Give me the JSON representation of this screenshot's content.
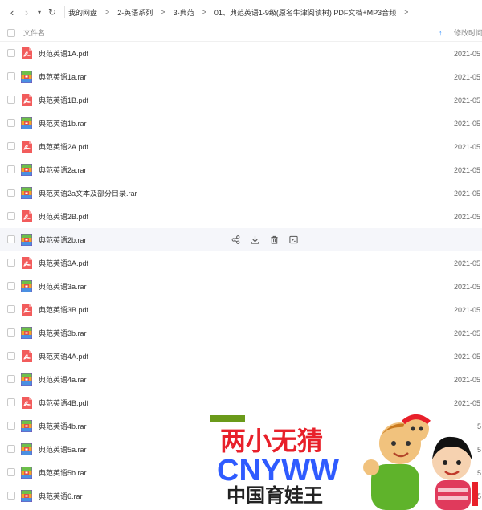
{
  "breadcrumb": [
    "我的网盘",
    "2-英语系列",
    "3-典范",
    "01、典范英语1-9级(原名牛津阅读树) PDF文档+MP3音频"
  ],
  "header": {
    "name": "文件名",
    "modified": "修改时间"
  },
  "files": [
    {
      "name": "典范英语1A.pdf",
      "type": "pdf",
      "date": "2021-05"
    },
    {
      "name": "典范英语1a.rar",
      "type": "rar",
      "date": "2021-05"
    },
    {
      "name": "典范英语1B.pdf",
      "type": "pdf",
      "date": "2021-05"
    },
    {
      "name": "典范英语1b.rar",
      "type": "rar",
      "date": "2021-05"
    },
    {
      "name": "典范英语2A.pdf",
      "type": "pdf",
      "date": "2021-05"
    },
    {
      "name": "典范英语2a.rar",
      "type": "rar",
      "date": "2021-05"
    },
    {
      "name": "典范英语2a文本及部分目录.rar",
      "type": "rar",
      "date": "2021-05"
    },
    {
      "name": "典范英语2B.pdf",
      "type": "pdf",
      "date": "2021-05"
    },
    {
      "name": "典范英语2b.rar",
      "type": "rar",
      "date": ""
    },
    {
      "name": "典范英语3A.pdf",
      "type": "pdf",
      "date": "2021-05"
    },
    {
      "name": "典范英语3a.rar",
      "type": "rar",
      "date": "2021-05"
    },
    {
      "name": "典范英语3B.pdf",
      "type": "pdf",
      "date": "2021-05"
    },
    {
      "name": "典范英语3b.rar",
      "type": "rar",
      "date": "2021-05"
    },
    {
      "name": "典范英语4A.pdf",
      "type": "pdf",
      "date": "2021-05"
    },
    {
      "name": "典范英语4a.rar",
      "type": "rar",
      "date": "2021-05"
    },
    {
      "name": "典范英语4B.pdf",
      "type": "pdf",
      "date": "2021-05"
    },
    {
      "name": "典范英语4b.rar",
      "type": "rar",
      "date": "5"
    },
    {
      "name": "典范英语5a.rar",
      "type": "rar",
      "date": "5"
    },
    {
      "name": "典范英语5b.rar",
      "type": "rar",
      "date": "5"
    },
    {
      "name": "典范英语6.rar",
      "type": "rar",
      "date": "5"
    }
  ],
  "hover_index": 8,
  "watermark": {
    "line1": "两小无猜",
    "line2": "CNYWW",
    "line3": "中国育娃王"
  },
  "colors": {
    "accent": "#2b8cff",
    "pdf": "#f25c5c",
    "watermark_red": "#e8202a",
    "watermark_blue": "#2f5bff"
  }
}
